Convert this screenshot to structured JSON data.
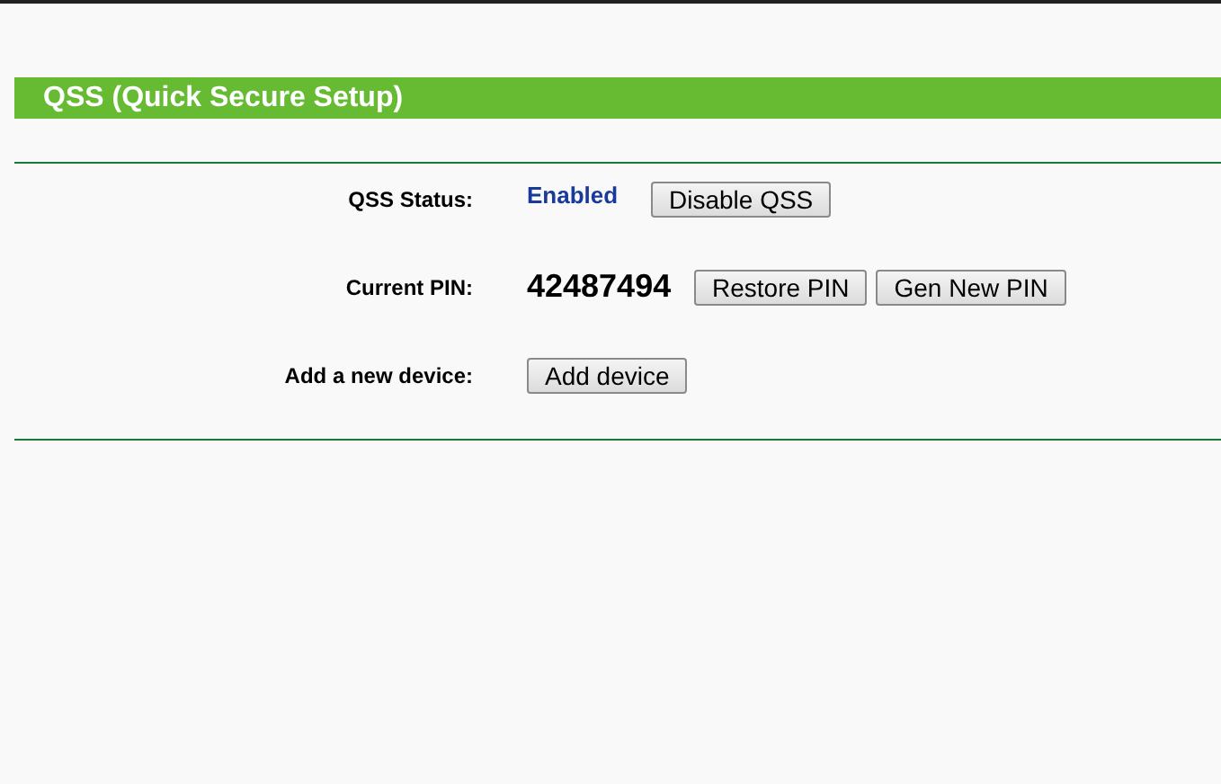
{
  "section": {
    "title": "QSS (Quick Secure Setup)"
  },
  "rows": [
    {
      "label": "QSS Status:",
      "kind": "status",
      "value": "Enabled",
      "buttons": [
        "Disable QSS"
      ]
    },
    {
      "label": "Current PIN:",
      "kind": "pin",
      "value": "42487494",
      "buttons": [
        "Restore PIN",
        "Gen New PIN"
      ]
    },
    {
      "label": "Add a new device:",
      "buttons": [
        "Add device"
      ]
    }
  ]
}
